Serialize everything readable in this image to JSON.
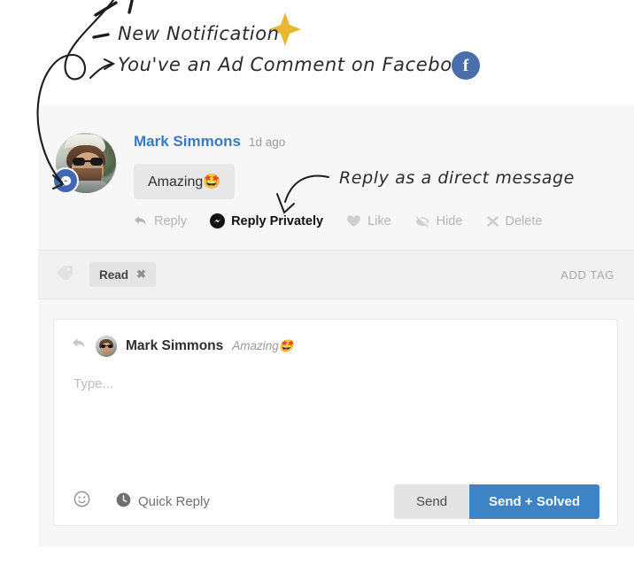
{
  "annotations": {
    "line1": "New Notification",
    "line2": "You've an Ad Comment on Facebook",
    "line3": "Reply as a direct message",
    "sparkle_color": "#e8b832",
    "facebook_badge_color": "#4a6ea9",
    "facebook_letter": "f"
  },
  "message": {
    "author": "Mark Simmons",
    "timestamp": "1d ago",
    "text": "Amazing",
    "emoji": "🤩",
    "avatar_alt": "Mark Simmons profile photo",
    "channel_badge": "facebook-messenger",
    "actions": [
      {
        "label": "Reply",
        "icon": "reply-arrow-icon",
        "active": false
      },
      {
        "label": "Reply Privately",
        "icon": "messenger-icon",
        "active": true
      },
      {
        "label": "Like",
        "icon": "heart-icon",
        "active": false
      },
      {
        "label": "Hide",
        "icon": "eye-slash-icon",
        "active": false
      },
      {
        "label": "Delete",
        "icon": "close-x-icon",
        "active": false
      }
    ]
  },
  "tagbar": {
    "icon": "tag-icon",
    "tags": [
      {
        "label": "Read",
        "remove": "✖"
      }
    ],
    "add_label": "ADD TAG"
  },
  "composer": {
    "reply_to_name": "Mark Simmons",
    "reply_to_quote": "Amazing",
    "reply_to_emoji": "🤩",
    "placeholder": "Type...",
    "emoji_button": "smiley-icon",
    "quick_reply_label": "Quick Reply",
    "quick_reply_icon": "clock-icon",
    "send_label": "Send",
    "send_solved_label": "Send + Solved",
    "send_solved_color": "#3d84c6"
  }
}
